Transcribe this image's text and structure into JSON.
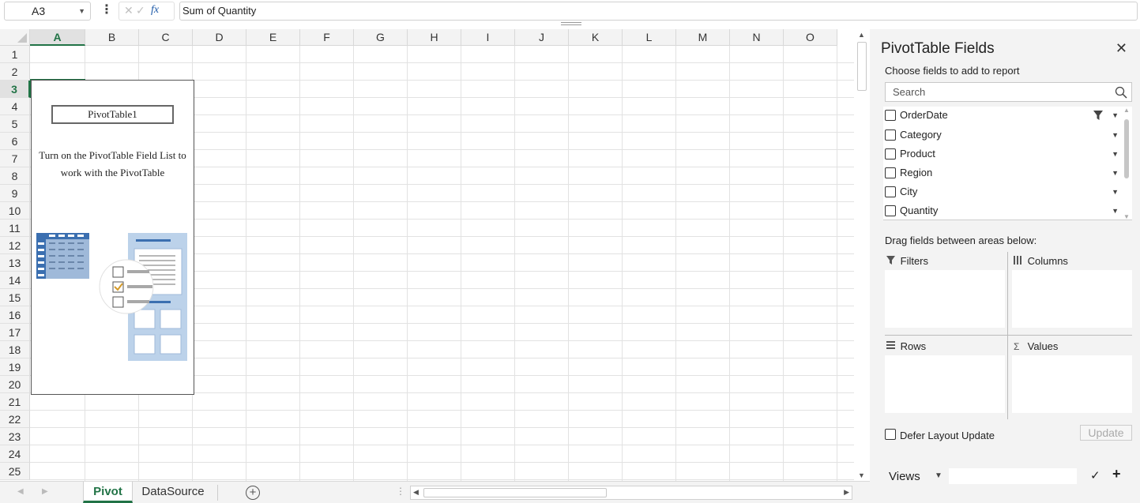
{
  "formula_bar": {
    "name_box": "A3",
    "cancel_glyph": "✕",
    "enter_glyph": "✓",
    "fx_glyph": "fx",
    "formula": "Sum of Quantity"
  },
  "grid": {
    "columns": [
      "A",
      "B",
      "C",
      "D",
      "E",
      "F",
      "G",
      "H",
      "I",
      "J",
      "K",
      "L",
      "M",
      "N",
      "O"
    ],
    "rows": [
      "1",
      "2",
      "3",
      "4",
      "5",
      "6",
      "7",
      "8",
      "9",
      "10",
      "11",
      "12",
      "13",
      "14",
      "15",
      "16",
      "17",
      "18",
      "19",
      "20",
      "21",
      "22",
      "23",
      "24",
      "25"
    ],
    "selected_column": "A",
    "selected_row": "3",
    "accent_color": "#217346"
  },
  "pivot_placeholder": {
    "name": "PivotTable1",
    "message": "Turn on the PivotTable Field List to work with the PivotTable"
  },
  "sheet_tabs": {
    "tabs": [
      {
        "label": "Pivot",
        "active": true
      },
      {
        "label": "DataSource",
        "active": false
      }
    ],
    "add_icon": "plus-circle-icon"
  },
  "field_panel": {
    "title": "PivotTable Fields",
    "subtitle": "Choose fields to add to report",
    "search_placeholder": "Search",
    "fields": [
      {
        "label": "OrderDate",
        "checked": false,
        "filtered": true
      },
      {
        "label": "Category",
        "checked": false,
        "filtered": false
      },
      {
        "label": "Product",
        "checked": false,
        "filtered": false
      },
      {
        "label": "Region",
        "checked": false,
        "filtered": false
      },
      {
        "label": "City",
        "checked": false,
        "filtered": false
      },
      {
        "label": "Quantity",
        "checked": false,
        "filtered": false
      }
    ],
    "drag_label": "Drag fields between areas below:",
    "areas": {
      "filters": "Filters",
      "columns": "Columns",
      "rows": "Rows",
      "values": "Values"
    },
    "defer_label": "Defer Layout Update",
    "update_button": "Update",
    "views_label": "Views",
    "views_check": "✓",
    "views_add": "+"
  }
}
